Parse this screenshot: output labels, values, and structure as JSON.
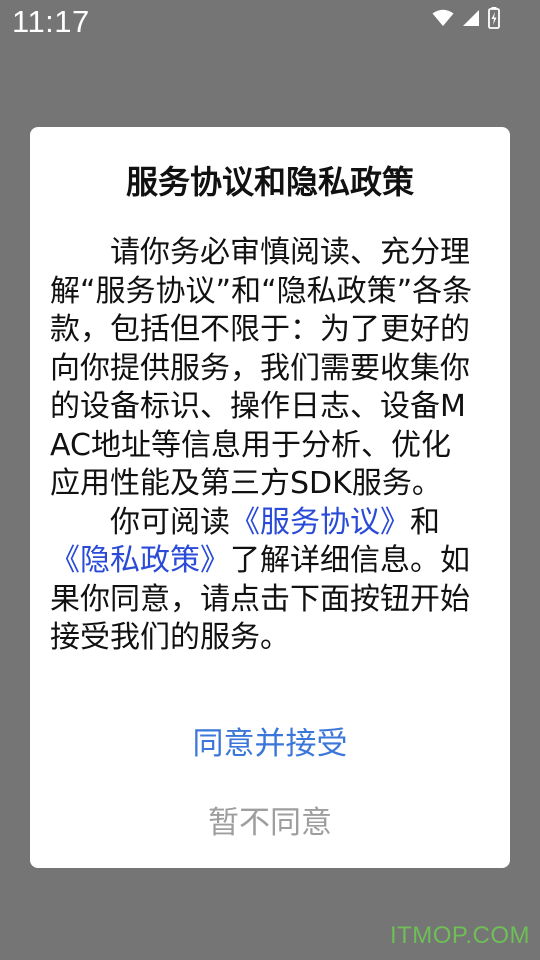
{
  "status_bar": {
    "time": "11:17",
    "icons": [
      "wifi-icon",
      "cellular-signal-icon",
      "battery-charging-icon"
    ]
  },
  "dialog": {
    "title": "服务协议和隐私政策",
    "paragraph1": "请你务必审慎阅读、充分理解“服务协议”和“隐私政策”各条款，包括但不限于：为了更好的向你提供服务，我们需要收集你的设备标识、操作日志、设备MAC地址等信息用于分析、优化应用性能及第三方SDK服务。",
    "paragraph2": {
      "prefix": "你可阅读",
      "service_link": "《服务协议》",
      "and": "和",
      "privacy_link": "《隐私政策》",
      "suffix": "了解详细信息。如果你同意，请点击下面按钮开始接受我们的服务。"
    },
    "agree_label": "同意并接受",
    "disagree_label": "暂不同意"
  },
  "watermark": "ITMOP.COM",
  "colors": {
    "overlay": "#757575",
    "link": "#2a4bd7",
    "agree": "#3a77d8",
    "disagree": "#9e9e9e",
    "watermark": "#6dbf56"
  }
}
